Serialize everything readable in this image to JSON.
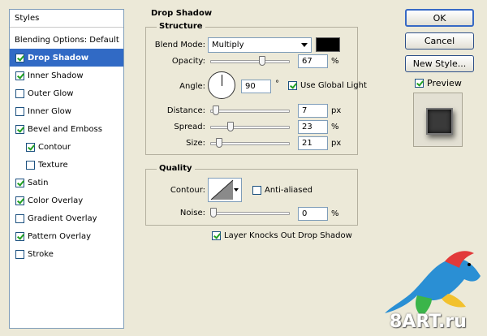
{
  "styles_panel": {
    "title": "Styles",
    "blending_options": "Blending Options: Default",
    "items": [
      {
        "label": "Drop Shadow",
        "checked": true,
        "selected": true,
        "sub": false
      },
      {
        "label": "Inner Shadow",
        "checked": true,
        "selected": false,
        "sub": false
      },
      {
        "label": "Outer Glow",
        "checked": false,
        "selected": false,
        "sub": false
      },
      {
        "label": "Inner Glow",
        "checked": false,
        "selected": false,
        "sub": false
      },
      {
        "label": "Bevel and Emboss",
        "checked": true,
        "selected": false,
        "sub": false
      },
      {
        "label": "Contour",
        "checked": true,
        "selected": false,
        "sub": true
      },
      {
        "label": "Texture",
        "checked": false,
        "selected": false,
        "sub": true
      },
      {
        "label": "Satin",
        "checked": true,
        "selected": false,
        "sub": false
      },
      {
        "label": "Color Overlay",
        "checked": true,
        "selected": false,
        "sub": false
      },
      {
        "label": "Gradient Overlay",
        "checked": false,
        "selected": false,
        "sub": false
      },
      {
        "label": "Pattern Overlay",
        "checked": true,
        "selected": false,
        "sub": false
      },
      {
        "label": "Stroke",
        "checked": false,
        "selected": false,
        "sub": false
      }
    ]
  },
  "drop_shadow": {
    "title": "Drop Shadow",
    "structure": {
      "title": "Structure",
      "blend_mode_label": "Blend Mode:",
      "blend_mode_value": "Multiply",
      "shadow_color": "#000000",
      "opacity_label": "Opacity:",
      "opacity_value": "67",
      "opacity_unit": "%",
      "opacity_fraction": 0.67,
      "angle_label": "Angle:",
      "angle_value": "90",
      "angle_unit": "°",
      "use_global_light_label": "Use Global Light",
      "use_global_light": true,
      "distance_label": "Distance:",
      "distance_value": "7",
      "distance_unit": "px",
      "distance_fraction": 0.03,
      "spread_label": "Spread:",
      "spread_value": "23",
      "spread_unit": "%",
      "spread_fraction": 0.23,
      "size_label": "Size:",
      "size_value": "21",
      "size_unit": "px",
      "size_fraction": 0.08
    },
    "quality": {
      "title": "Quality",
      "contour_label": "Contour:",
      "anti_aliased_label": "Anti-aliased",
      "anti_aliased": false,
      "noise_label": "Noise:",
      "noise_value": "0",
      "noise_unit": "%",
      "noise_fraction": 0
    },
    "knockout_label": "Layer Knocks Out Drop Shadow",
    "knockout": true
  },
  "buttons": {
    "ok": "OK",
    "cancel": "Cancel",
    "new_style": "New Style..."
  },
  "preview": {
    "label": "Preview",
    "checked": true
  },
  "watermark": {
    "text": "8ART.ru",
    "icon": "parrot-logo"
  }
}
